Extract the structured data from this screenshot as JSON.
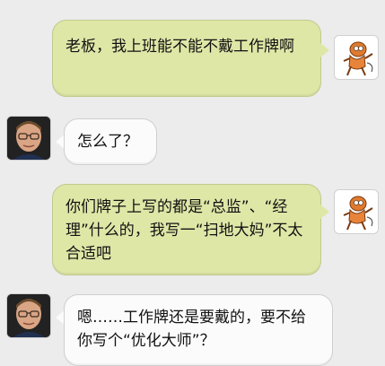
{
  "messages": [
    {
      "sender": "me",
      "text": "老板，我上班能不能不戴工作牌啊"
    },
    {
      "sender": "boss",
      "text": "怎么了？"
    },
    {
      "sender": "me",
      "text": "你们牌子上写的都是“总监”、“经理”什么的，我写一“扫地大妈”不太合适吧"
    },
    {
      "sender": "boss",
      "text": "嗯……工作牌还是要戴的，要不给你写个“优化大师”？"
    }
  ],
  "icons": {
    "me_avatar": "cartoon-character-avatar-icon",
    "boss_avatar": "man-with-glasses-avatar-icon"
  },
  "colors": {
    "background": "#ececec",
    "my_bubble": "#dfe7a7",
    "other_bubble": "#fbfbfb"
  }
}
